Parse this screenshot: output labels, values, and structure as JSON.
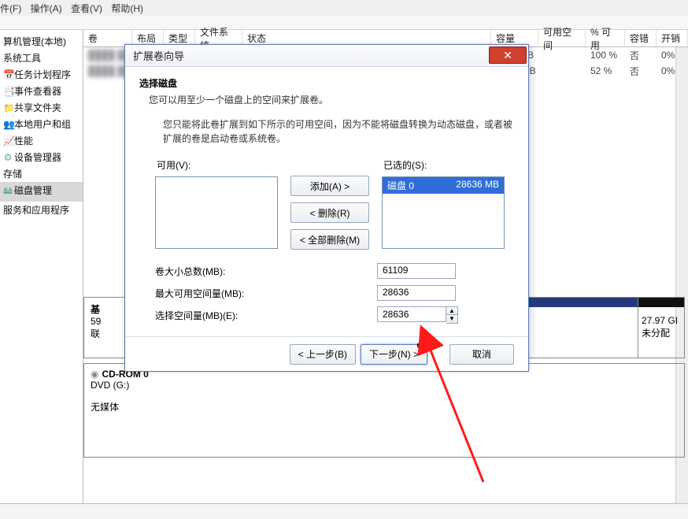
{
  "menubar": {
    "file": "件(F)",
    "action": "操作(A)",
    "view": "查看(V)",
    "help": "帮助(H)"
  },
  "tree": {
    "root": "算机管理(本地)",
    "systools": "系统工具",
    "sched": "任务计划程序",
    "event": "事件查看器",
    "share": "共享文件夹",
    "users": "本地用户和组",
    "perf": "性能",
    "devmgr": "设备管理器",
    "storage": "存储",
    "diskmgmt": "磁盘管理",
    "services": "服务和应用程序"
  },
  "vol_head": {
    "vol": "卷",
    "layout": "布局",
    "type": "类型",
    "fs": "文件系统",
    "status": "状态",
    "cap": "容量",
    "free": "可用空间",
    "pct": "% 可用",
    "fault": "容错",
    "oh": "开销"
  },
  "rows": [
    {
      "tail_cap": "B",
      "pct": "100 %",
      "fault": "否",
      "oh": "0%"
    },
    {
      "tail_cap": "iB",
      "pct": "52 %",
      "fault": "否",
      "oh": "0%"
    }
  ],
  "lower": {
    "basic": "基",
    "pct": "59",
    "online": "联",
    "seg_c_size": "27.97 GI",
    "seg_c_state": "未分配",
    "cdrom": "CD-ROM 0",
    "dvd": "DVD (G:)",
    "nomedia": "无媒体"
  },
  "modal": {
    "title": "扩展卷向导",
    "sect_h": "选择磁盘",
    "sect_sub": "您可以用至少一个磁盘上的空间来扩展卷。",
    "note": "您只能将此卷扩展到如下所示的可用空间，因为不能将磁盘转换为动态磁盘，或者被扩展的卷是启动卷或系统卷。",
    "available_lbl": "可用(V):",
    "selected_lbl": "已选的(S):",
    "sel_item": {
      "name": "磁盘 0",
      "size": "28636 MB"
    },
    "btn_add": "添加(A) >",
    "btn_remove": "< 删除(R)",
    "btn_remove_all": "< 全部删除(M)",
    "row_total": "卷大小总数(MB):",
    "row_max": "最大可用空间量(MB):",
    "row_sel": "选择空间量(MB)(E):",
    "val_total": "61109",
    "val_max": "28636",
    "val_sel": "28636",
    "btn_back": "< 上一步(B)",
    "btn_next": "下一步(N) >",
    "btn_cancel": "取消"
  }
}
